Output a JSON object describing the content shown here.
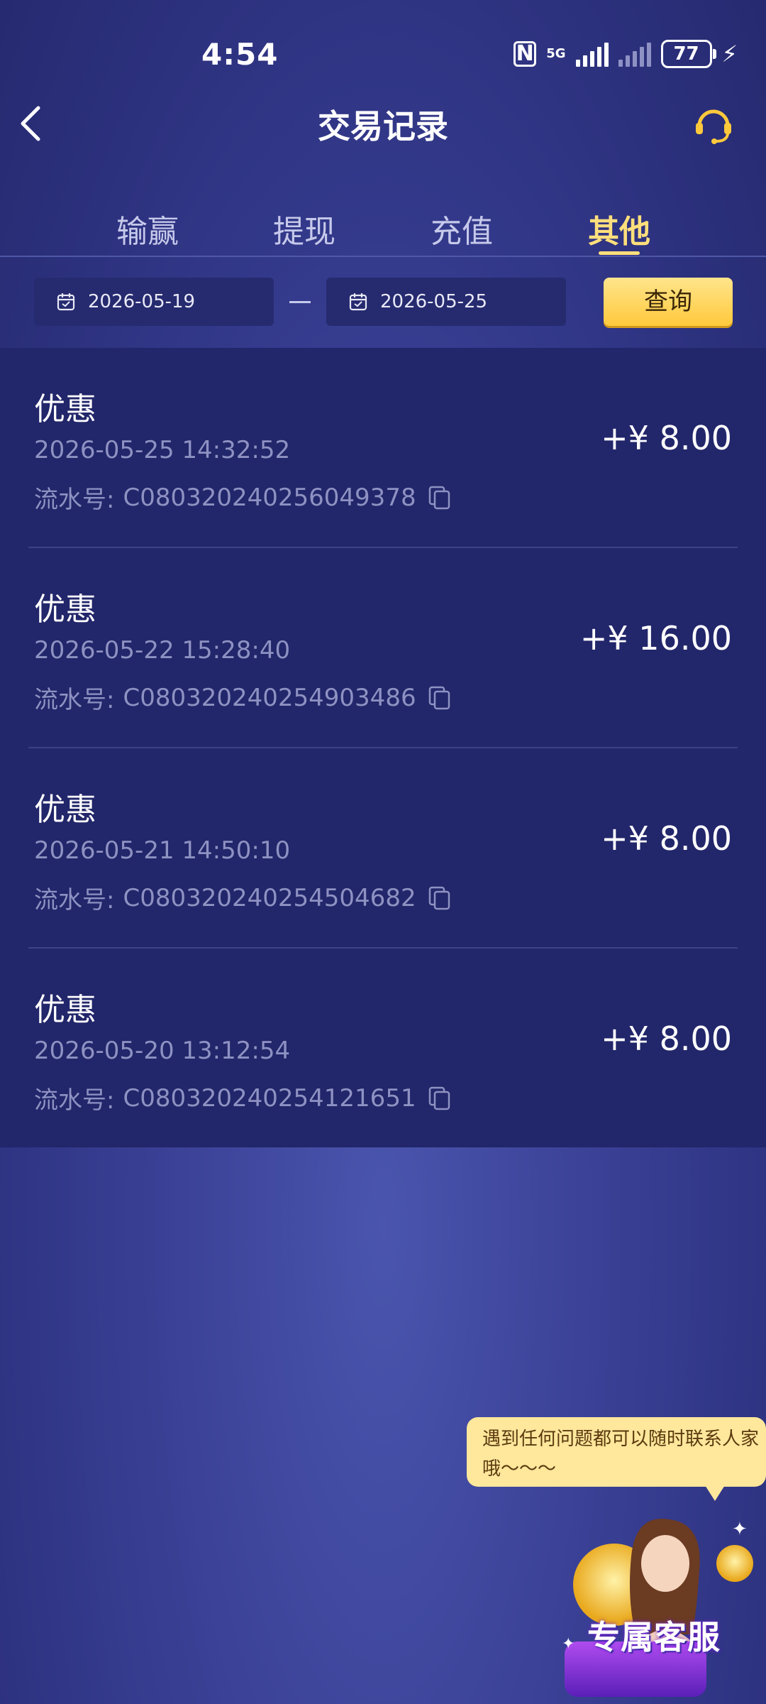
{
  "status_bar": {
    "time": "4:54",
    "network_label": "5G",
    "battery": "77"
  },
  "header": {
    "title": "交易记录"
  },
  "tabs": [
    {
      "label": "输赢",
      "active": false
    },
    {
      "label": "提现",
      "active": false
    },
    {
      "label": "充值",
      "active": false
    },
    {
      "label": "其他",
      "active": true
    }
  ],
  "filter": {
    "start_date": "2026-05-19",
    "end_date": "2026-05-25",
    "query_label": "查询"
  },
  "records": [
    {
      "title": "优惠",
      "time": "2026-05-25 14:32:52",
      "serial_label": "流水号:",
      "serial": "C080320240256049378",
      "amount": "+¥ 8.00"
    },
    {
      "title": "优惠",
      "time": "2026-05-22 15:28:40",
      "serial_label": "流水号:",
      "serial": "C080320240254903486",
      "amount": "+¥ 16.00"
    },
    {
      "title": "优惠",
      "time": "2026-05-21 14:50:10",
      "serial_label": "流水号:",
      "serial": "C080320240254504682",
      "amount": "+¥ 8.00"
    },
    {
      "title": "优惠",
      "time": "2026-05-20 13:12:54",
      "serial_label": "流水号:",
      "serial": "C080320240254121651",
      "amount": "+¥ 8.00"
    }
  ],
  "support_bubble": {
    "text": "遇到任何问题都可以随时联系人家哦～～～"
  },
  "mascot": {
    "text": "专属客服"
  },
  "colors": {
    "accent": "#ffdf7b",
    "list_bg": "#22266a",
    "button": "#ffd24d"
  }
}
